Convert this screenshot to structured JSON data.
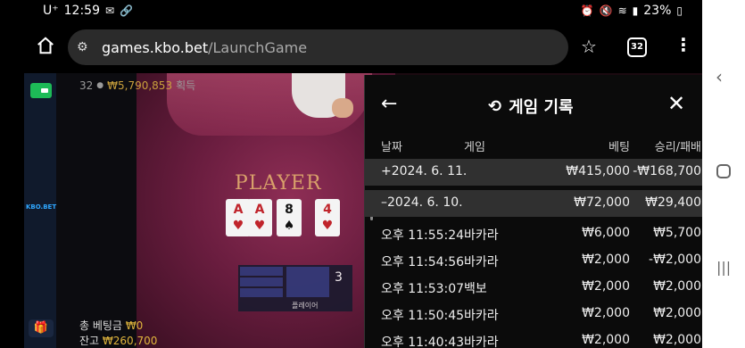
{
  "status_bar": {
    "carrier": "U⁺",
    "time": "12:59",
    "battery": "23%"
  },
  "browser": {
    "url_host": "games.kbo.bet",
    "url_path": "/LaunchGame",
    "tab_count": "32"
  },
  "game": {
    "brand": "KBO.BET",
    "players_count": "32",
    "winnings_amount": "₩5,790,853",
    "winnings_label": "획득",
    "table_label": "PLAYER",
    "cards": [
      {
        "rank": "A",
        "suit": "♥"
      },
      {
        "rank": "A",
        "suit": "♥"
      },
      {
        "rank": "8",
        "suit": "♠"
      },
      {
        "rank": "4",
        "suit": "♥"
      }
    ],
    "bet_panel_number": "3",
    "bet_panel_label": "플레이어",
    "total_bet_label": "총 베팅금",
    "total_bet_value": "₩0",
    "balance_label": "잔고",
    "balance_value": "₩260,700"
  },
  "history": {
    "title": "게임 기록",
    "columns": {
      "date": "날짜",
      "game": "게임",
      "bet": "베팅",
      "result": "승리/패배"
    },
    "rows": [
      {
        "date": "+2024. 6. 11.",
        "game": "",
        "bet": "₩415,000",
        "result": "-₩168,700",
        "group": true
      },
      {
        "date": "–2024. 6. 10.",
        "game": "",
        "bet": "₩72,000",
        "result": "₩29,400",
        "group": true
      },
      {
        "date": "오후 11:55:24",
        "game": "바카라",
        "bet": "₩6,000",
        "result": "₩5,700",
        "group": false
      },
      {
        "date": "오후 11:54:56",
        "game": "바카라",
        "bet": "₩2,000",
        "result": "-₩2,000",
        "group": false
      },
      {
        "date": "오후 11:53:07",
        "game": "백보",
        "bet": "₩2,000",
        "result": "₩2,000",
        "group": false
      },
      {
        "date": "오후 11:50:45",
        "game": "바카라",
        "bet": "₩2,000",
        "result": "₩2,000",
        "group": false
      },
      {
        "date": "오후 11:40:43",
        "game": "바카라",
        "bet": "₩2,000",
        "result": "₩2,000",
        "group": false
      }
    ]
  }
}
